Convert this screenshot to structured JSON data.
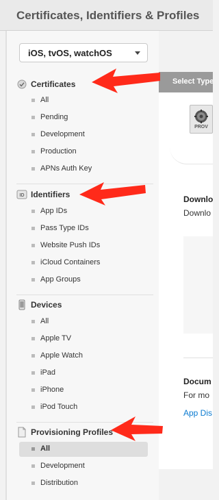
{
  "header": {
    "title": "Certificates, Identifiers & Profiles"
  },
  "platform": {
    "selected": "iOS, tvOS, watchOS"
  },
  "sections": {
    "certificates": {
      "title": "Certificates",
      "icon": "certificate-icon",
      "items": [
        "All",
        "Pending",
        "Development",
        "Production",
        "APNs Auth Key"
      ]
    },
    "identifiers": {
      "title": "Identifiers",
      "icon": "id-badge-icon",
      "items": [
        "App IDs",
        "Pass Type IDs",
        "Website Push IDs",
        "iCloud Containers",
        "App Groups"
      ]
    },
    "devices": {
      "title": "Devices",
      "icon": "device-icon",
      "items": [
        "All",
        "Apple TV",
        "Apple Watch",
        "iPad",
        "iPhone",
        "iPod Touch"
      ]
    },
    "profiles": {
      "title": "Provisioning Profiles",
      "icon": "document-icon",
      "items": [
        "All",
        "Development",
        "Distribution"
      ],
      "selected_index": 0
    }
  },
  "content": {
    "select_type_label": "Select Type",
    "file_icon_label": "PROV",
    "download_heading": "Downlo",
    "download_text": "Downlo",
    "documentation_heading": "Docum",
    "documentation_text": "For mo",
    "link_text": "App Dis"
  },
  "annotation": {
    "arrow_color": "#ff2a1a"
  }
}
